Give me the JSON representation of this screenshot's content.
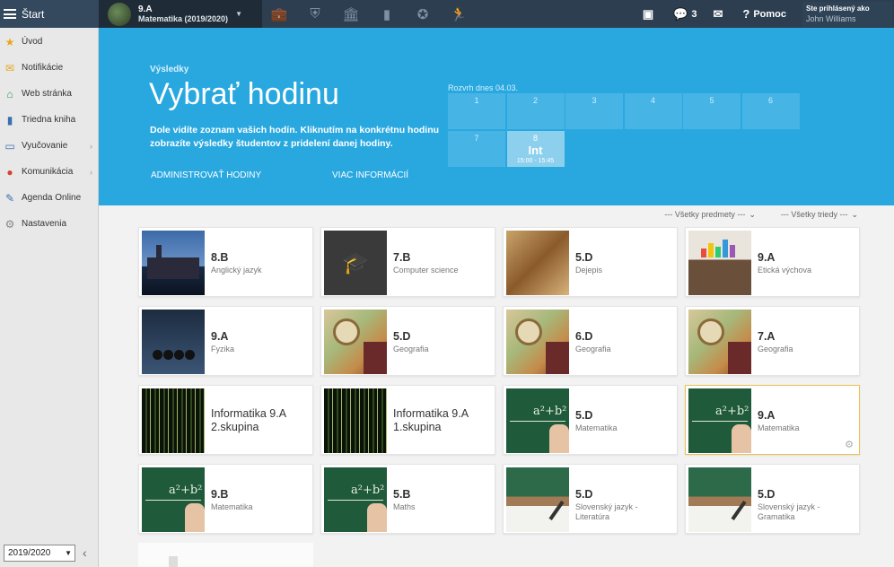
{
  "topbar": {
    "start_label": "Štart",
    "class_name": "9.A",
    "class_subject": "Matematika (2019/2020)",
    "nav_icons": [
      "briefcase-icon",
      "shield-icon",
      "institution-icon",
      "chart-icon",
      "compass-icon",
      "runner-icon"
    ],
    "cast_icon": "cast-icon",
    "messages_count": "3",
    "mail_icon": "mail-icon",
    "help_label": "Pomoc",
    "logged_in_label": "Ste prihlásený ako",
    "user_name": "John Williams"
  },
  "sidebar": {
    "items": [
      {
        "label": "Úvod",
        "icon": "star-icon",
        "color": "#e6a817",
        "arrow": false
      },
      {
        "label": "Notifikácie",
        "icon": "envelope-icon",
        "color": "#e6a817",
        "arrow": false
      },
      {
        "label": "Web stránka",
        "icon": "home-icon",
        "color": "#2e9a4c",
        "arrow": false
      },
      {
        "label": "Triedna kniha",
        "icon": "book-icon",
        "color": "#3a6fb0",
        "arrow": false
      },
      {
        "label": "Vyučovanie",
        "icon": "open-book-icon",
        "color": "#3a6fb0",
        "arrow": true
      },
      {
        "label": "Komunikácia",
        "icon": "chat-icon",
        "color": "#d0452f",
        "arrow": true
      },
      {
        "label": "Agenda Online",
        "icon": "pencil-icon",
        "color": "#3a6fb0",
        "arrow": false
      },
      {
        "label": "Nastavenia",
        "icon": "gear-icon",
        "color": "#888888",
        "arrow": false
      }
    ],
    "year": "2019/2020"
  },
  "hero": {
    "eyebrow": "Výsledky",
    "title": "Vybrať hodinu",
    "description": "Dole vidíte zoznam vašich hodín. Kliknutím na konkrétnu hodinu zobrazíte výsledky študentov z pridelení danej hodiny.",
    "link_admin": "ADMINISTROVAŤ HODINY",
    "link_more": "VIAC INFORMÁCIÍ",
    "schedule_label": "Rozvrh dnes 04.03.",
    "schedule": [
      {
        "n": "1"
      },
      {
        "n": "2"
      },
      {
        "n": "3"
      },
      {
        "n": "4"
      },
      {
        "n": "5"
      },
      {
        "n": "6"
      },
      {
        "n": "7"
      },
      {
        "n": "8",
        "subject": "Int",
        "time": "15:00 - 15:45",
        "active": true
      }
    ]
  },
  "filters": {
    "subjects": "--- Všetky predmety ---",
    "classes": "--- Všetky triedy ---"
  },
  "cards": [
    {
      "cls": "8.B",
      "subject": "Anglický jazyk",
      "thumb": "london"
    },
    {
      "cls": "7.B",
      "subject": "Computer science",
      "thumb": "cs"
    },
    {
      "cls": "5.D",
      "subject": "Dejepis",
      "thumb": "egypt"
    },
    {
      "cls": "9.A",
      "subject": "Etická výchova",
      "thumb": "etics"
    },
    {
      "cls": "9.A",
      "subject": "Fyzika",
      "thumb": "fyz"
    },
    {
      "cls": "5.D",
      "subject": "Geografia",
      "thumb": "geo"
    },
    {
      "cls": "6.D",
      "subject": "Geografia",
      "thumb": "geo"
    },
    {
      "cls": "7.A",
      "subject": "Geografia",
      "thumb": "geo"
    },
    {
      "cls": "Informatika 9.A 2.skupina",
      "subject": "",
      "thumb": "inf"
    },
    {
      "cls": "Informatika 9.A 1.skupina",
      "subject": "",
      "thumb": "inf"
    },
    {
      "cls": "5.D",
      "subject": "Matematika",
      "thumb": "mat"
    },
    {
      "cls": "9.A",
      "subject": "Matematika",
      "thumb": "mat",
      "selected": true
    },
    {
      "cls": "9.B",
      "subject": "Matematika",
      "thumb": "mat"
    },
    {
      "cls": "5.B",
      "subject": "Maths",
      "thumb": "mat"
    },
    {
      "cls": "5.D",
      "subject": "Slovenský jazyk - Literatúra",
      "thumb": "sj"
    },
    {
      "cls": "5.D",
      "subject": "Slovenský jazyk - Gramatika",
      "thumb": "sj"
    }
  ]
}
